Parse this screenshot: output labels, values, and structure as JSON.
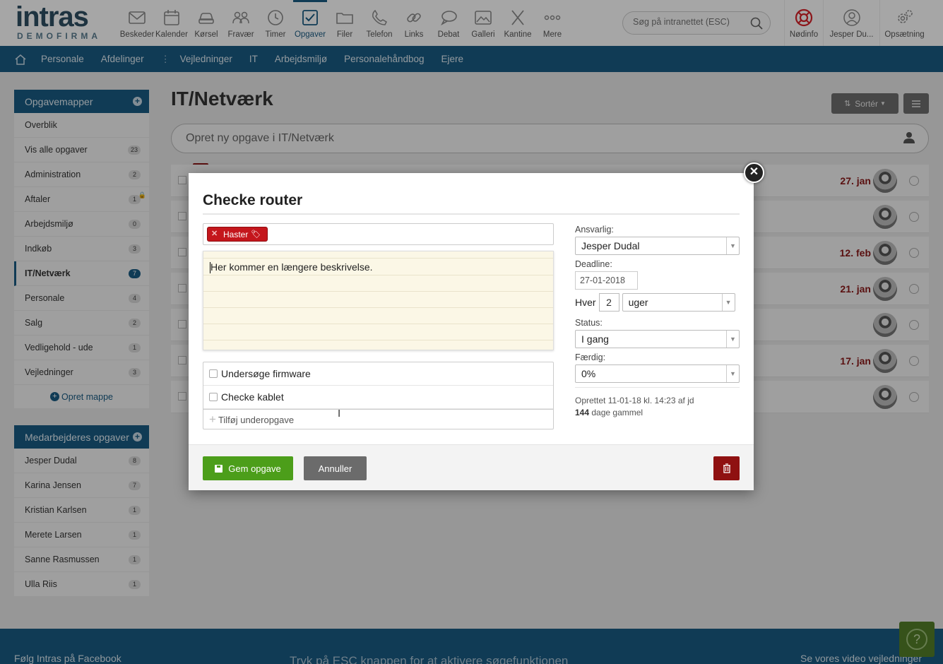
{
  "logo": {
    "main": "intras",
    "sub": "DEMOFIRMA"
  },
  "nav": {
    "items": [
      {
        "label": "Beskeder",
        "icon": "envelope-icon"
      },
      {
        "label": "Kalender",
        "icon": "calendar-icon"
      },
      {
        "label": "Kørsel",
        "icon": "car-icon"
      },
      {
        "label": "Fravær",
        "icon": "people-icon"
      },
      {
        "label": "Timer",
        "icon": "clock-icon"
      },
      {
        "label": "Opgaver",
        "icon": "checkbox-icon",
        "active": true
      },
      {
        "label": "Filer",
        "icon": "folder-icon"
      },
      {
        "label": "Telefon",
        "icon": "phone-icon"
      },
      {
        "label": "Links",
        "icon": "link-icon"
      },
      {
        "label": "Debat",
        "icon": "chat-icon"
      },
      {
        "label": "Galleri",
        "icon": "image-icon"
      },
      {
        "label": "Kantine",
        "icon": "cutlery-icon"
      },
      {
        "label": "Mere",
        "icon": "more-icon"
      }
    ],
    "search_placeholder": "Søg på intranettet (ESC)",
    "right": [
      {
        "label": "Nødinfo",
        "icon": "lifebuoy-icon"
      },
      {
        "label": "Jesper Du...",
        "icon": "user-icon"
      },
      {
        "label": "Opsætning",
        "icon": "gears-icon"
      }
    ]
  },
  "subnav": [
    "Personale",
    "Afdelinger",
    "Vejledninger",
    "IT",
    "Arbejdsmiljø",
    "Personalehåndbog",
    "Ejere"
  ],
  "sidebar": {
    "folders_title": "Opgavemapper",
    "folders": [
      {
        "label": "Overblik",
        "count": ""
      },
      {
        "label": "Vis alle opgaver",
        "count": "23"
      },
      {
        "label": "Administration",
        "count": "2"
      },
      {
        "label": "Aftaler",
        "count": "1"
      },
      {
        "label": "Arbejdsmiljø",
        "count": "0"
      },
      {
        "label": "Indkøb",
        "count": "3"
      },
      {
        "label": "IT/Netværk",
        "count": "7"
      },
      {
        "label": "Personale",
        "count": "4"
      },
      {
        "label": "Salg",
        "count": "2"
      },
      {
        "label": "Vedligehold - ude",
        "count": "1"
      },
      {
        "label": "Vejledninger",
        "count": "3"
      }
    ],
    "create_folder": "Opret mappe",
    "colleagues_title": "Medarbejderes opgaver",
    "colleagues": [
      {
        "label": "Jesper Dudal",
        "count": "8"
      },
      {
        "label": "Karina Jensen",
        "count": "7"
      },
      {
        "label": "Kristian Karlsen",
        "count": "1"
      },
      {
        "label": "Merete Larsen",
        "count": "1"
      },
      {
        "label": "Sanne Rasmussen",
        "count": "1"
      },
      {
        "label": "Ulla Riis",
        "count": "1"
      }
    ]
  },
  "main": {
    "title": "IT/Netværk",
    "sort_label": "Sortér",
    "new_task_placeholder": "Opret ny opgave i IT/Netværk",
    "rows": [
      {
        "date": "27. jan"
      },
      {
        "date": ""
      },
      {
        "date": "12. feb"
      },
      {
        "date": "21. jan"
      },
      {
        "date": ""
      },
      {
        "date": "17. jan"
      },
      {
        "date": ""
      }
    ]
  },
  "modal": {
    "title": "Checke router",
    "tag": "Haster",
    "description": "Her kommer en længere beskrivelse.",
    "subtasks": [
      "Undersøge firmware",
      "Checke kablet"
    ],
    "add_subtask": "Tilføj underopgave",
    "responsible_label": "Ansvarlig:",
    "responsible_value": "Jesper Dudal",
    "deadline_label": "Deadline:",
    "deadline_value": "27-01-2018",
    "repeat_label": "Hver",
    "repeat_number": "2",
    "repeat_unit": "uger",
    "status_label": "Status:",
    "status_value": "I gang",
    "done_label": "Færdig:",
    "done_value": "0%",
    "created_text": "Oprettet 11-01-18 kl. 14:23 af jd",
    "age_days": "144",
    "age_suffix": "dage gammel",
    "save_label": "Gem opgave",
    "cancel_label": "Annuller"
  },
  "footer": {
    "facebook": "Følg Intras på Facebook",
    "hint": "Tryk på ESC knappen for at aktivere søgefunktionen",
    "video": "Se vores video vejledninger"
  },
  "colors": {
    "brand": "#1a5b83",
    "save": "#4c9e1a",
    "danger": "#8f1111",
    "tag": "#c4161c"
  }
}
